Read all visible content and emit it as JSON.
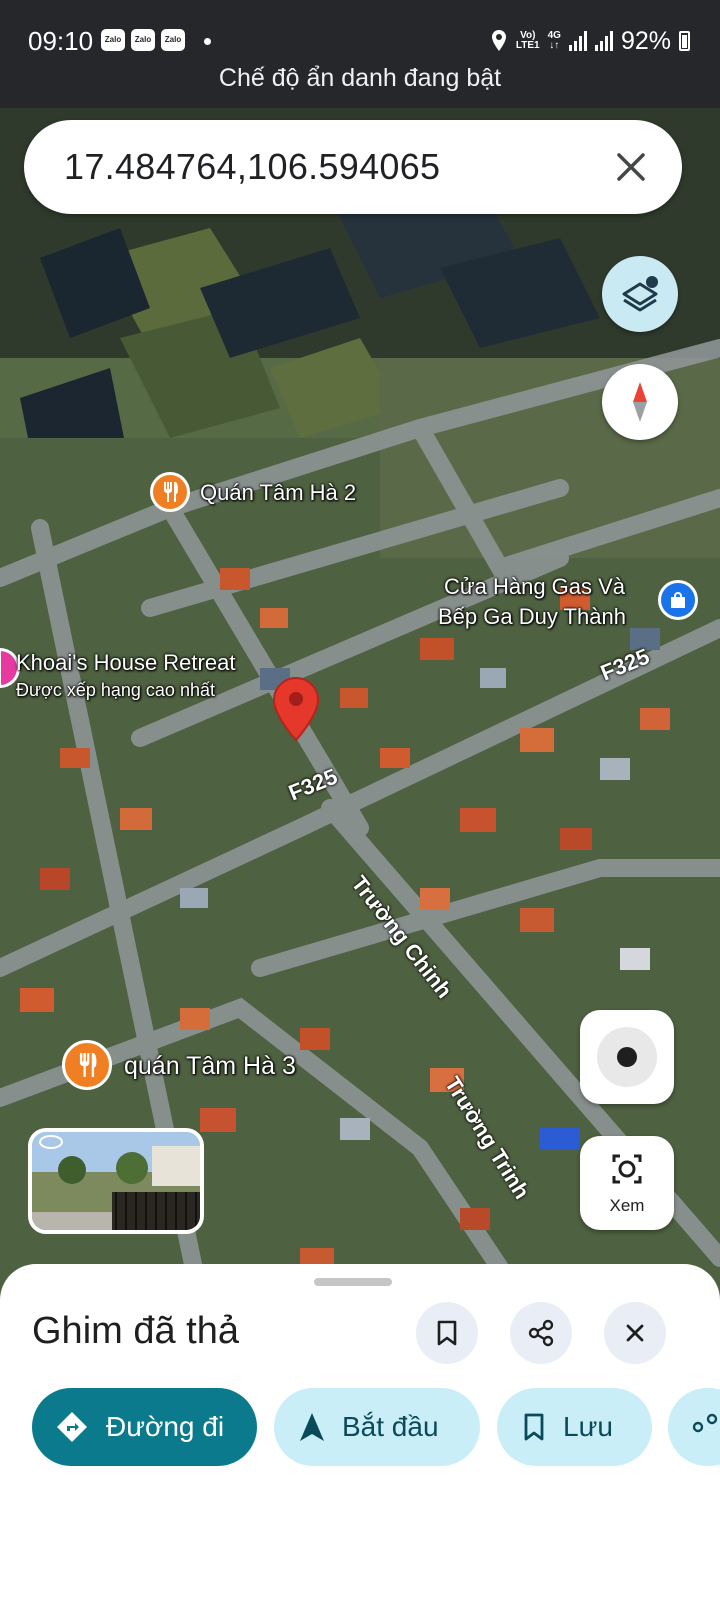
{
  "status_bar": {
    "time": "09:10",
    "notification_apps": [
      "Zalo",
      "Zalo",
      "Zalo"
    ],
    "network_top": "Vo)",
    "network_bottom": "LTE1",
    "data_type": "4G",
    "battery": "92%"
  },
  "incognito_banner": "Chế độ ẩn danh đang bật",
  "search": {
    "value": "17.484764,106.594065"
  },
  "map": {
    "pois": [
      {
        "name": "Quán Tâm Hà 2",
        "icon": "restaurant-icon"
      },
      {
        "name": "Cửa Hàng Gas Và",
        "name_line2": "Bếp Ga Duy Thành",
        "icon": "shopping-bag-icon"
      },
      {
        "name": "Khoai's House Retreat",
        "subtitle": "Được xếp hạng cao nhất",
        "icon": "hotel-icon"
      },
      {
        "name": "quán Tâm Hà 3",
        "icon": "restaurant-icon"
      }
    ],
    "roads": [
      "F325",
      "F325",
      "Trường Chinh",
      "Trường Trinh"
    ],
    "buttons": {
      "xem_label": "Xem"
    }
  },
  "place_sheet": {
    "title": "Ghim đã thả",
    "actions": {
      "directions": "Đường đi",
      "start": "Bắt đầu",
      "save": "Lưu"
    }
  },
  "colors": {
    "primary": "#0b7a8c",
    "chip_bg": "#c9eef7",
    "pin_red": "#e5372a",
    "poi_orange": "#f07f23"
  }
}
